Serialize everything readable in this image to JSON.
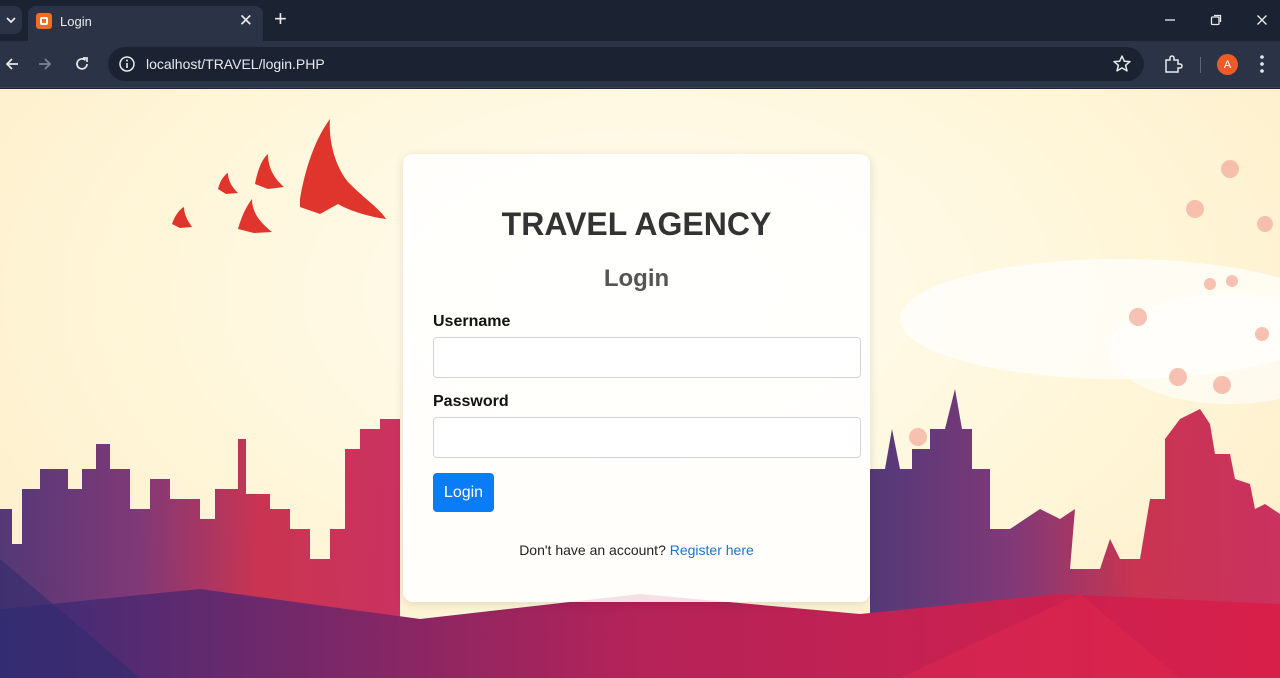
{
  "browser": {
    "tab_title": "Login",
    "url": "localhost/TRAVEL/login.PHP",
    "profile_initial": "A",
    "icons": [
      "tab-search-icon",
      "xampp-favicon",
      "close-icon",
      "plus-icon",
      "minimize-icon",
      "restore-icon",
      "close-window-icon",
      "back-icon",
      "forward-icon",
      "reload-icon",
      "info-icon",
      "star-icon",
      "extensions-icon",
      "menu-icon"
    ]
  },
  "page": {
    "brand": "TRAVEL AGENCY",
    "heading": "Login",
    "username_label": "Username",
    "username_value": "",
    "password_label": "Password",
    "password_value": "",
    "submit_label": "Login",
    "register_prompt": "Don't have an account?",
    "register_link": "Register here"
  },
  "colors": {
    "primary_button": "#0a7cf7",
    "link": "#1a73c9",
    "chrome_dark": "#1b2333",
    "chrome_toolbar": "#2b3447"
  }
}
